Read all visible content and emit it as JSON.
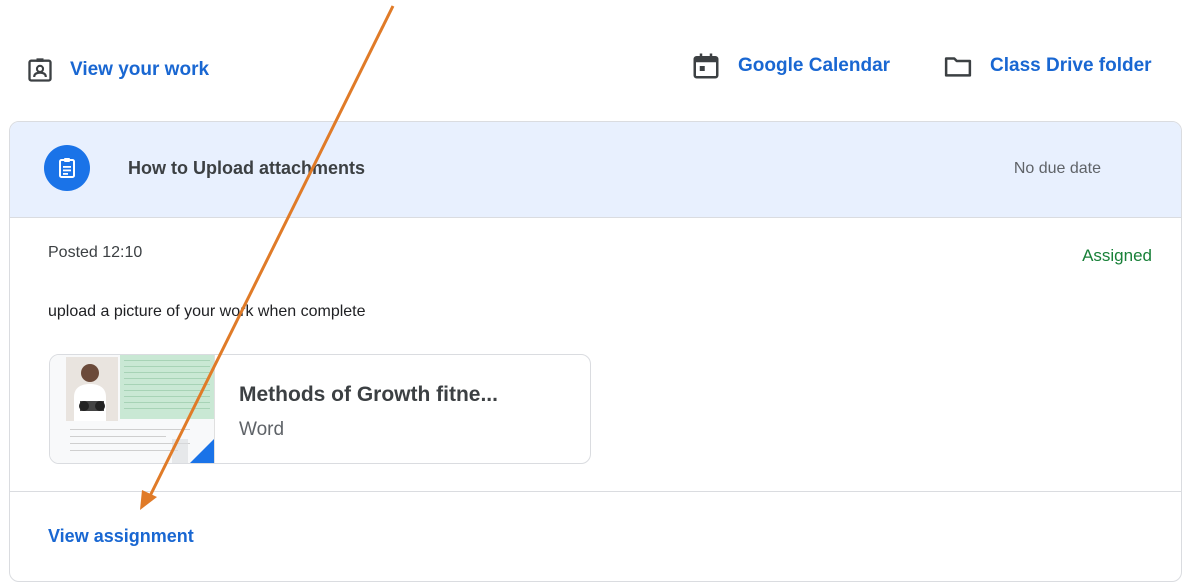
{
  "top_links": {
    "view_work": "View your work",
    "calendar": "Google Calendar",
    "drive": "Class Drive folder"
  },
  "assignment": {
    "title": "How to Upload attachments",
    "due": "No due date",
    "posted": "Posted 12:10",
    "status": "Assigned",
    "description": "upload a picture of your work when complete",
    "view_label": "View assignment"
  },
  "attachment": {
    "title": "Methods of Growth fitne...",
    "type": "Word"
  },
  "icons": {
    "view_work": "assignment-ind-icon",
    "calendar": "calendar-icon",
    "drive": "folder-icon",
    "assignment": "assignment-icon"
  },
  "colors": {
    "link": "#1967d2",
    "header_bg": "#e8f0fe",
    "icon_circle": "#1a73e8",
    "status_green": "#188038",
    "annotation_arrow": "#e07b28"
  }
}
